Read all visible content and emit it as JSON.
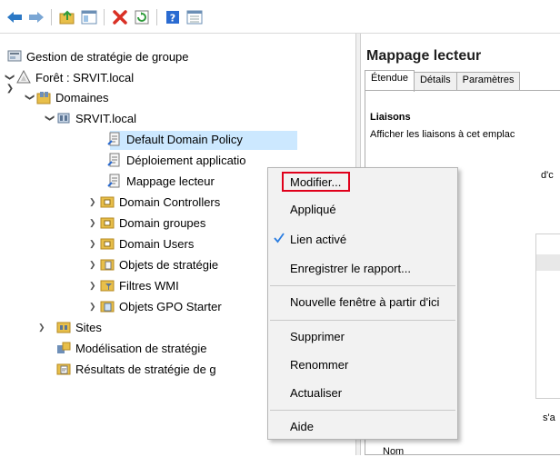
{
  "toolbar": {
    "icons": [
      "back-arrow-icon",
      "forward-arrow-icon",
      "folder-up-icon",
      "properties-icon",
      "delete-icon",
      "refresh-icon",
      "help-icon",
      "panel-icon"
    ],
    "colors": {
      "arrow": "#2b78c5",
      "delete": "#d93025",
      "refresh": "#2e9b3a",
      "help": "#2a6bd1"
    }
  },
  "tree": {
    "root": "Gestion de stratégie de groupe",
    "forest": "Forêt : SRVIT.local",
    "domains": "Domaines",
    "domain": "SRVIT.local",
    "gpos": [
      "Default Domain Policy",
      "Déploiement applicatio",
      "Mappage lecteur"
    ],
    "ous": [
      "Domain Controllers",
      "Domain groupes",
      "Domain Users"
    ],
    "gpo_objects": "Objets de stratégie",
    "wmi": "Filtres WMI",
    "starter": "Objets GPO Starter",
    "sites": "Sites",
    "modeling": "Modélisation de stratégie",
    "results": "Résultats de stratégie de g"
  },
  "right": {
    "title": "Mappage lecteur",
    "tabs": [
      "Étendue",
      "Détails",
      "Paramètres"
    ],
    "section": "Liaisons",
    "section_text": "Afficher les liaisons à cet emplac",
    "frag1": "d'c",
    "frag2": "s'a",
    "frag3": "Nom"
  },
  "menu": {
    "items": [
      "Modifier...",
      "Appliqué",
      "Lien activé",
      "Enregistrer le rapport...",
      "Nouvelle fenêtre à partir d'ici",
      "Supprimer",
      "Renommer",
      "Actualiser",
      "Aide"
    ],
    "checked": "Lien activé",
    "highlight_color": "#e0001b"
  }
}
